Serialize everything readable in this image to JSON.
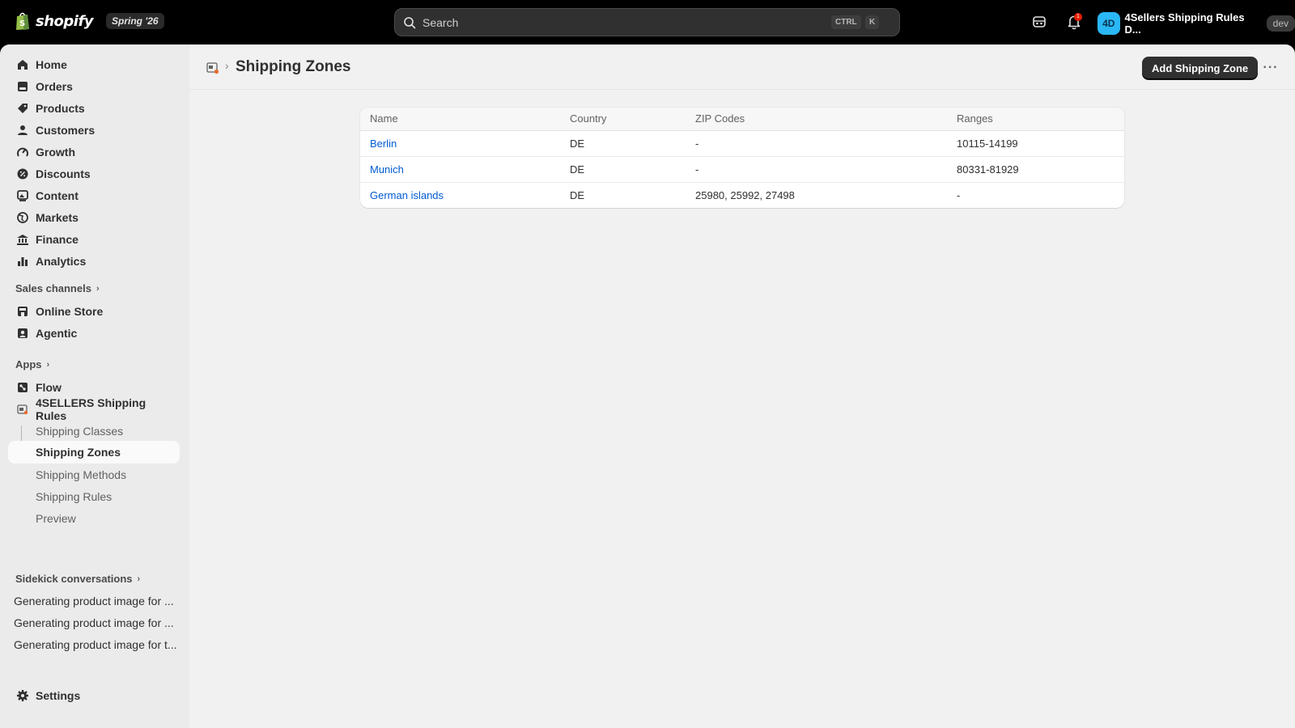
{
  "topbar": {
    "brand": "shopify",
    "edition": "Spring '26",
    "search": {
      "placeholder": "Search",
      "shortcut_1": "CTRL",
      "shortcut_2": "K"
    },
    "notification_count": "1",
    "store": {
      "initials": "4D",
      "name": "4Sellers Shipping Rules D...",
      "badge": "dev"
    }
  },
  "sidebar": {
    "main_items": [
      {
        "label": "Home",
        "icon": "home-icon"
      },
      {
        "label": "Orders",
        "icon": "orders-icon"
      },
      {
        "label": "Products",
        "icon": "tag-icon"
      },
      {
        "label": "Customers",
        "icon": "person-icon"
      },
      {
        "label": "Growth",
        "icon": "growth-icon"
      },
      {
        "label": "Discounts",
        "icon": "discount-icon"
      },
      {
        "label": "Content",
        "icon": "content-icon"
      },
      {
        "label": "Markets",
        "icon": "globe-icon"
      },
      {
        "label": "Finance",
        "icon": "bank-icon"
      },
      {
        "label": "Analytics",
        "icon": "bar-chart-icon"
      }
    ],
    "sales_channels": {
      "title": "Sales channels",
      "items": [
        {
          "label": "Online Store"
        },
        {
          "label": "Agentic"
        }
      ]
    },
    "apps": {
      "title": "Apps",
      "items": [
        {
          "label": "Flow"
        },
        {
          "label": "4SELLERS Shipping Rules"
        }
      ],
      "sub_items": [
        {
          "label": "Shipping Classes"
        },
        {
          "label": "Shipping Zones",
          "active": true
        },
        {
          "label": "Shipping Methods"
        },
        {
          "label": "Shipping Rules"
        },
        {
          "label": "Preview"
        }
      ]
    },
    "sidekick": {
      "title": "Sidekick conversations",
      "items": [
        {
          "label": "Generating product image for ..."
        },
        {
          "label": "Generating product image for ..."
        },
        {
          "label": "Generating product image for t..."
        }
      ]
    },
    "settings_label": "Settings"
  },
  "page": {
    "title": "Shipping Zones",
    "primary_action": "Add Shipping Zone",
    "more_actions": "···"
  },
  "table": {
    "columns": [
      "Name",
      "Country",
      "ZIP Codes",
      "Ranges"
    ],
    "rows": [
      {
        "name": "Berlin",
        "country": "DE",
        "zip": "-",
        "ranges": "10115-14199"
      },
      {
        "name": "Munich",
        "country": "DE",
        "zip": "-",
        "ranges": "80331-81929"
      },
      {
        "name": "German islands",
        "country": "DE",
        "zip": "25980, 25992, 27498",
        "ranges": "-"
      }
    ]
  },
  "colors": {
    "link": "#005bd3",
    "topbar_bg": "#000000",
    "primary_button": "#303030",
    "avatar": "#2ab7f5",
    "notification": "#e51c00"
  }
}
